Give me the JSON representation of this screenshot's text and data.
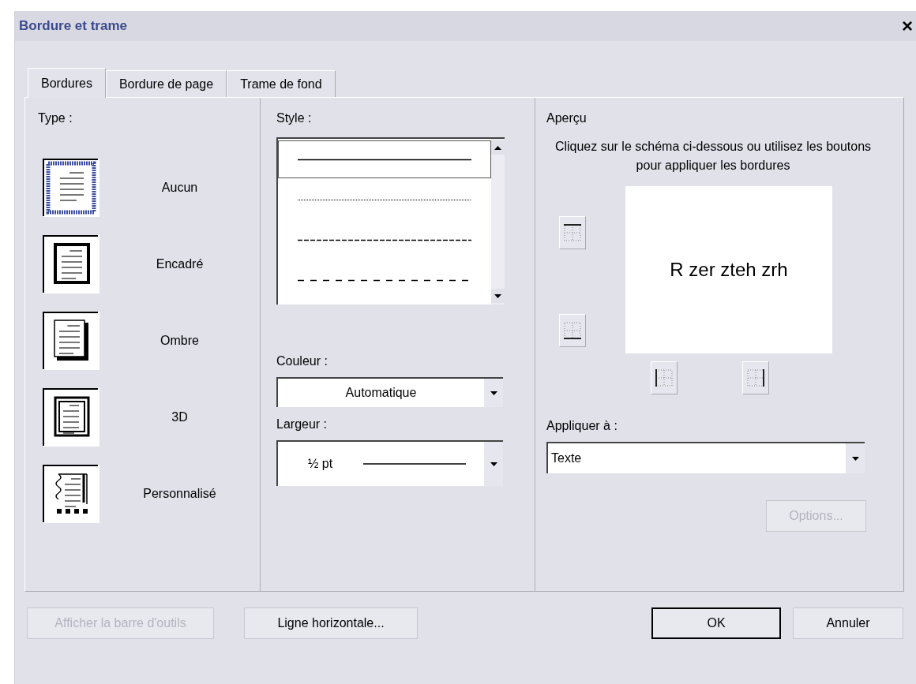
{
  "window": {
    "title": "Bordure et trame",
    "close": "×"
  },
  "tabs": [
    {
      "label": "Bordures",
      "selected": true
    },
    {
      "label": "Bordure de page",
      "selected": false
    },
    {
      "label": "Trame de fond",
      "selected": false
    }
  ],
  "type": {
    "label": "Type :",
    "items": [
      {
        "kind": "none",
        "label": "Aucun",
        "selected": true
      },
      {
        "kind": "box",
        "label": "Encadré",
        "selected": false
      },
      {
        "kind": "shadow",
        "label": "Ombre",
        "selected": false
      },
      {
        "kind": "raised",
        "label": "3D",
        "selected": false
      },
      {
        "kind": "custom",
        "label": "Personnalisé",
        "selected": false
      }
    ]
  },
  "style": {
    "label": "Style :",
    "items": [
      {
        "kind": "solid",
        "selected": true
      },
      {
        "kind": "dotted",
        "selected": false
      },
      {
        "kind": "dashed",
        "selected": false
      },
      {
        "kind": "long-dashed",
        "selected": false
      }
    ]
  },
  "color": {
    "label": "Couleur :",
    "value": "Automatique"
  },
  "width": {
    "label": "Largeur :",
    "value": "½ pt"
  },
  "preview": {
    "title": "Aperçu",
    "hint": "Cliquez sur le schéma ci-dessous ou utilisez les boutons pour appliquer les bordures",
    "sample": "R zer zteh zrh",
    "edge_buttons": [
      {
        "kind": "top"
      },
      {
        "kind": "bottom"
      },
      {
        "kind": "left"
      },
      {
        "kind": "right"
      }
    ]
  },
  "apply_to": {
    "label": "Appliquer à :",
    "value": "Texte"
  },
  "options_button": {
    "label": "Options...",
    "disabled": true,
    "default": false
  },
  "footer_buttons": [
    {
      "label": "Afficher la barre d'outils",
      "disabled": true,
      "default": false
    },
    {
      "label": "Ligne horizontale...",
      "disabled": false,
      "default": false
    },
    {
      "label": "OK",
      "disabled": false,
      "default": true
    },
    {
      "label": "Annuler",
      "disabled": false,
      "default": false
    }
  ]
}
